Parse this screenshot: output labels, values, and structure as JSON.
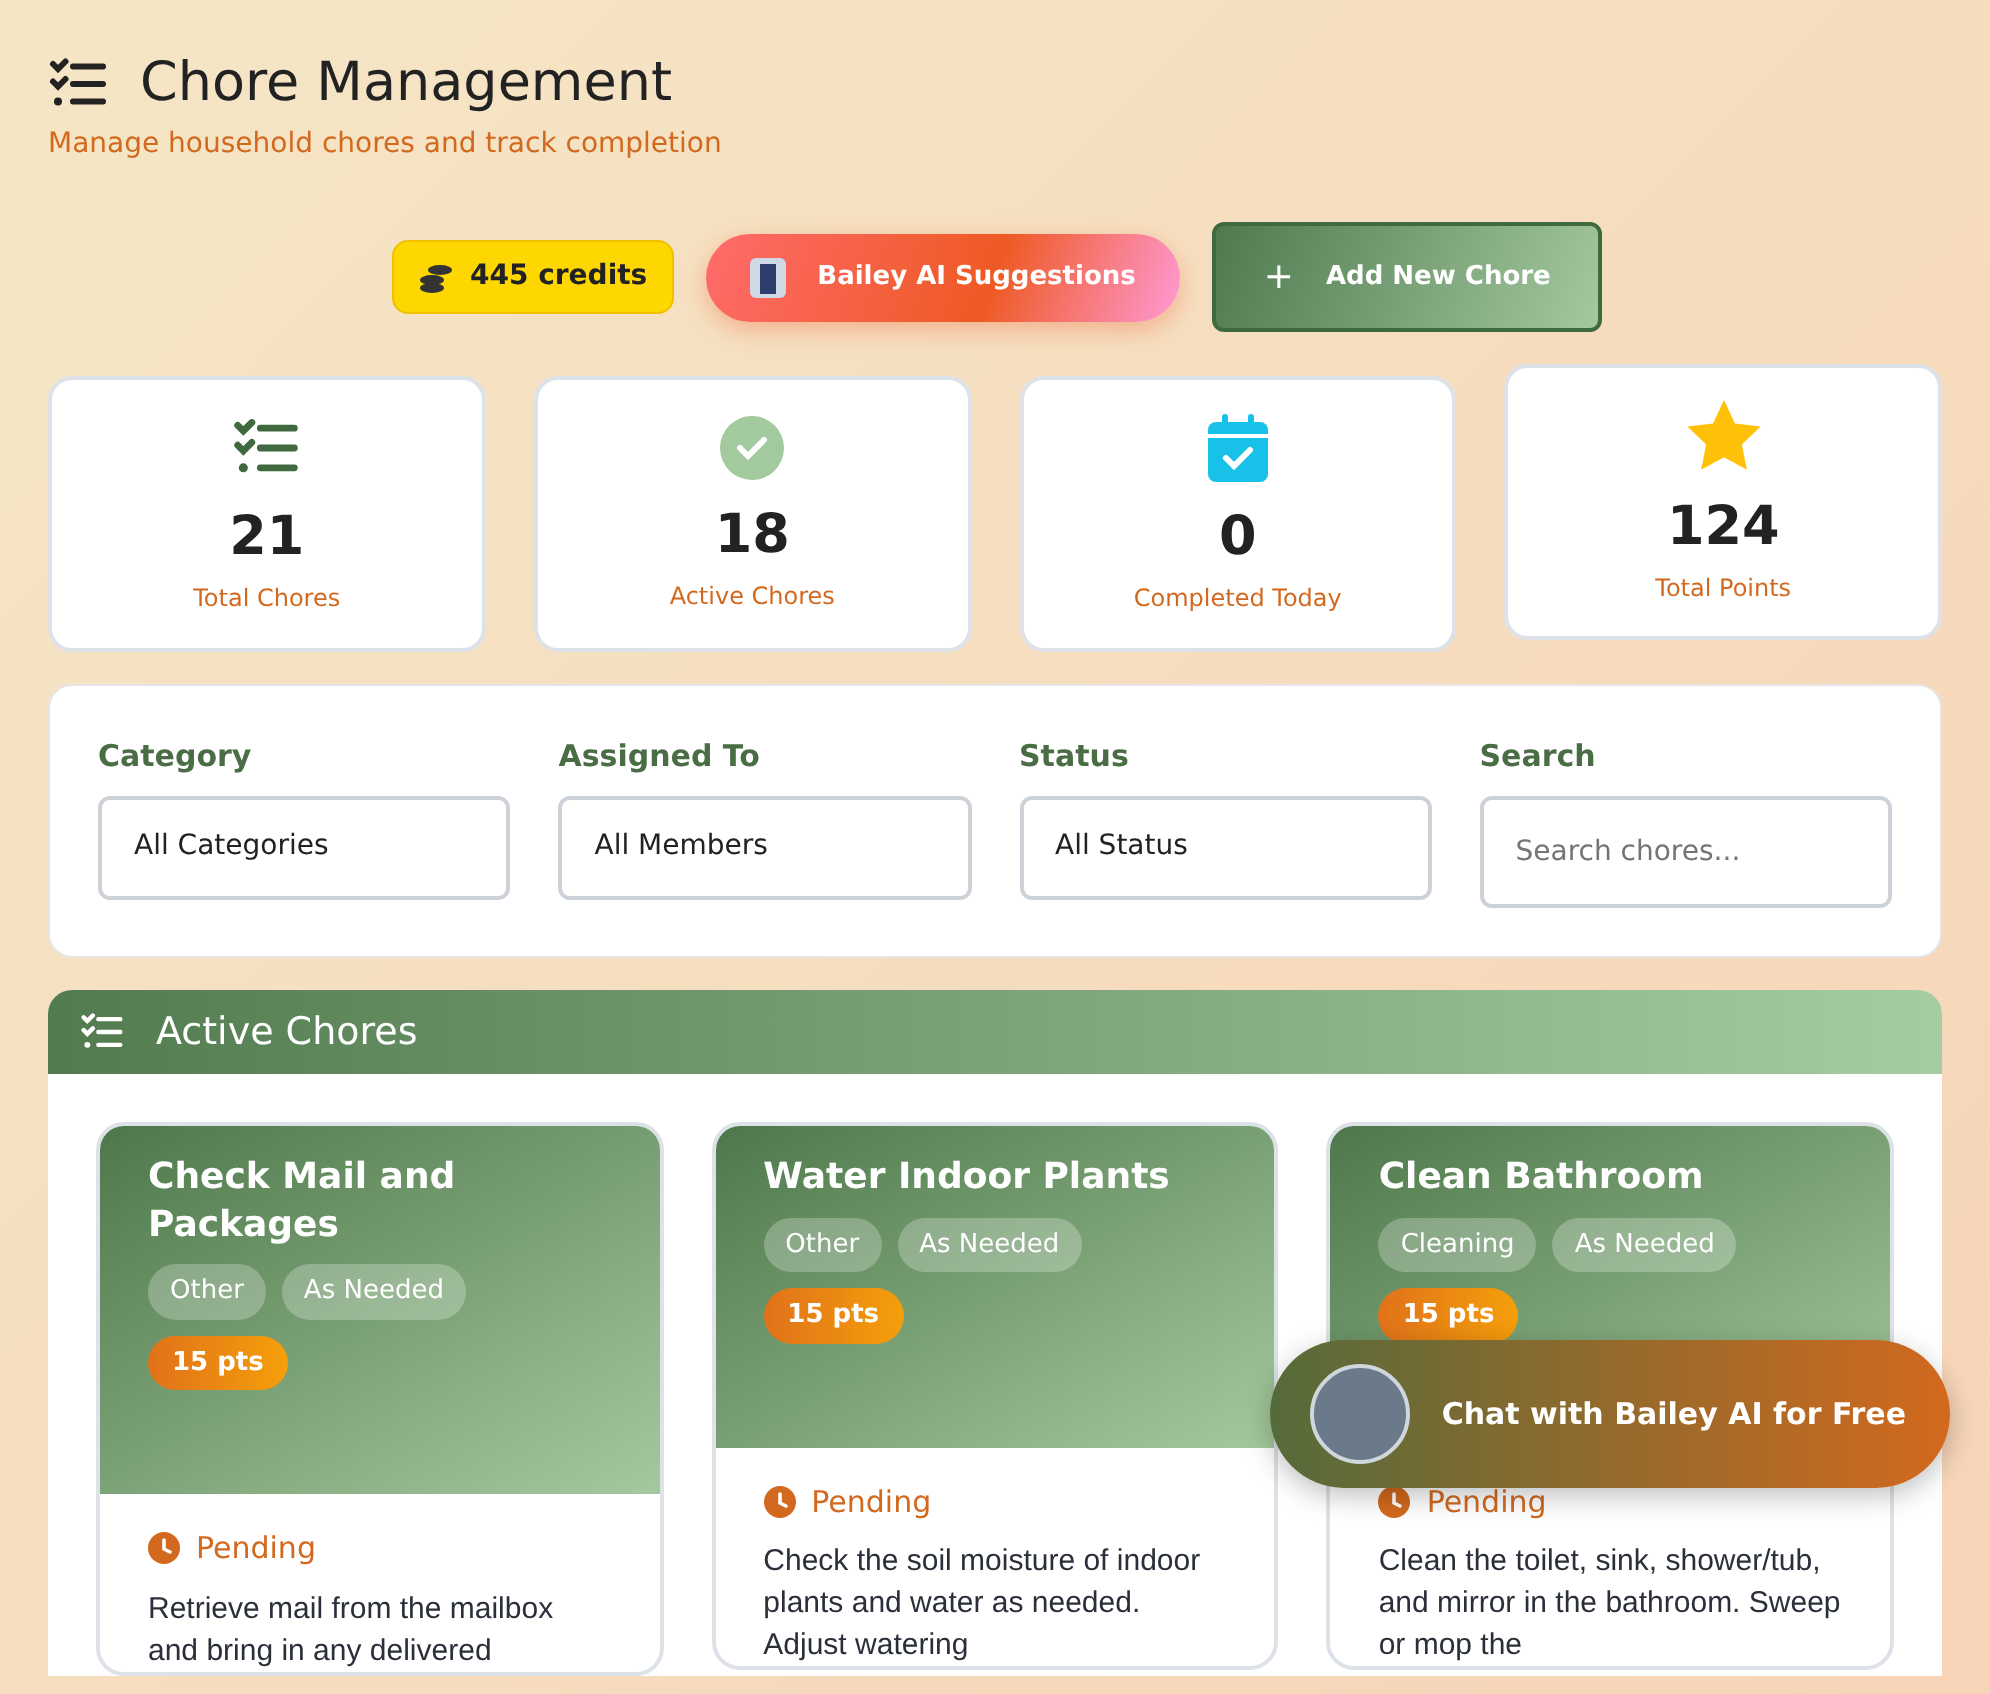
{
  "header": {
    "title": "Chore Management",
    "subtitle": "Manage household chores and track completion"
  },
  "actions": {
    "credits": "445 credits",
    "ai_button": "Bailey AI Suggestions",
    "add_button": "Add New Chore",
    "add_icon": "+"
  },
  "stats": [
    {
      "value": "21",
      "label": "Total Chores"
    },
    {
      "value": "18",
      "label": "Active Chores"
    },
    {
      "value": "0",
      "label": "Completed Today"
    },
    {
      "value": "124",
      "label": "Total Points"
    }
  ],
  "filters": [
    {
      "kind": "select",
      "label": "Category",
      "value": "All Categories"
    },
    {
      "kind": "select",
      "label": "Assigned To",
      "value": "All Members"
    },
    {
      "kind": "select",
      "label": "Status",
      "value": "All Status"
    },
    {
      "kind": "input",
      "label": "Search",
      "placeholder": "Search chores..."
    }
  ],
  "panel": {
    "title": "Active Chores"
  },
  "chores": [
    {
      "title": "Check Mail and Packages",
      "tags": [
        "Other",
        "As Needed"
      ],
      "points": "15 pts",
      "status": "Pending",
      "description": "Retrieve mail from the mailbox and bring in any delivered"
    },
    {
      "title": "Water Indoor Plants",
      "tags": [
        "Other",
        "As Needed"
      ],
      "points": "15 pts",
      "status": "Pending",
      "description": "Check the soil moisture of indoor plants and water as needed. Adjust watering"
    },
    {
      "title": "Clean Bathroom",
      "tags": [
        "Cleaning",
        "As Needed"
      ],
      "points": "15 pts",
      "status": "Pending",
      "description": "Clean the toilet, sink, shower/tub, and mirror in the bathroom. Sweep or mop the"
    }
  ],
  "chat_button": "Chat with Bailey AI for Free"
}
